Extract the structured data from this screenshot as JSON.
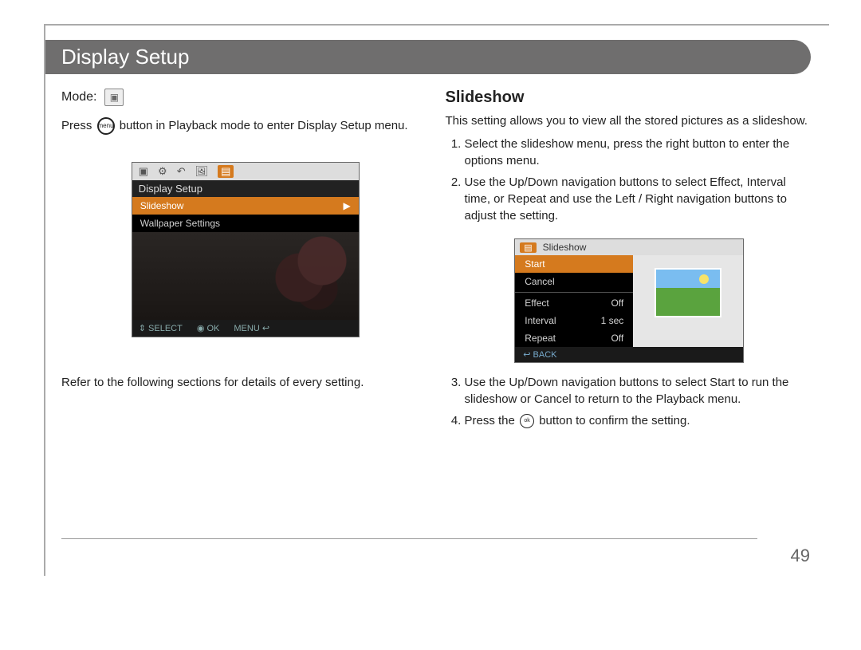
{
  "title": "Display Setup",
  "left": {
    "mode_label": "Mode:",
    "mode_icon_name": "playback-mode-icon",
    "press_prefix": "Press",
    "press_button_icon": "menu",
    "press_suffix": "button in Playback mode to enter Display Setup menu.",
    "caption": "Refer to the following sections for details of every setting."
  },
  "screenshot1": {
    "top_icons": [
      "▣",
      "⚙",
      "↶",
      "🖼"
    ],
    "top_active": "▤",
    "header": "Display Setup",
    "row_selected": "Slideshow",
    "row_selected_arrow": "▶",
    "row2": "Wallpaper Settings",
    "footer": {
      "select": "⇕ SELECT",
      "ok": "◉ OK",
      "menu": "MENU ↩"
    }
  },
  "right": {
    "heading": "Slideshow",
    "intro": "This setting allows you to view all the stored pictures as a slideshow.",
    "steps_a": [
      "Select the slideshow menu, press the right button to enter the options menu.",
      "Use the Up/Down navigation buttons to select Effect, Interval time, or Repeat and use the Left / Right navigation buttons to adjust the setting."
    ],
    "steps_b": [
      "Use the Up/Down navigation buttons to select Start to run the slideshow or Cancel to return to the Playback menu."
    ],
    "step4_prefix": "Press the",
    "step4_icon": "func\nok",
    "step4_suffix": "button to confirm the setting."
  },
  "screenshot2": {
    "top_label": "Slideshow",
    "rows_top": [
      {
        "label": "Start",
        "selected": true
      },
      {
        "label": "Cancel",
        "selected": false
      }
    ],
    "rows_bottom": [
      {
        "label": "Effect",
        "value": "Off"
      },
      {
        "label": "Interval",
        "value": "1 sec"
      },
      {
        "label": "Repeat",
        "value": "Off"
      }
    ],
    "footer": "↩ BACK"
  },
  "page_number": "49"
}
